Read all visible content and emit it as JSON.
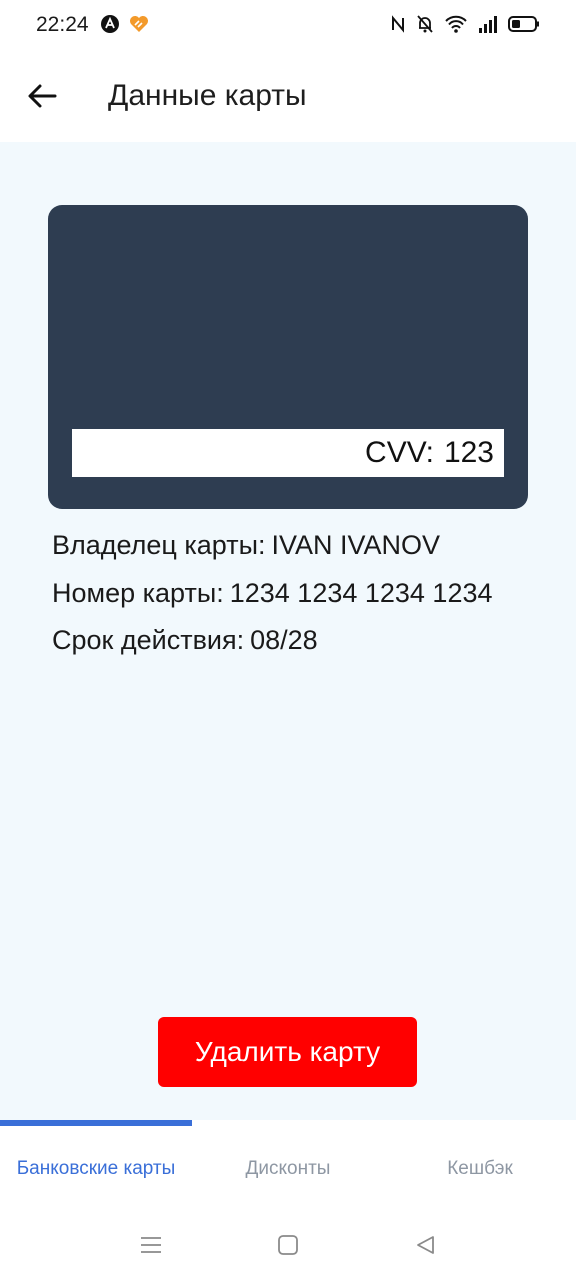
{
  "status_bar": {
    "time": "22:24",
    "left_icons": [
      "app-a-icon",
      "heart-app-icon"
    ],
    "right_icons": [
      "nfc-icon",
      "bell-off-icon",
      "wifi-icon",
      "signal-icon",
      "battery-icon"
    ]
  },
  "header": {
    "back_icon": "arrow-left-icon",
    "title": "Данные карты"
  },
  "card": {
    "cvv_label": "CVV:",
    "cvv_value": "123"
  },
  "details": {
    "owner_label": "Владелец карты:",
    "owner_value": "IVAN IVANOV",
    "number_label": "Номер карты:",
    "number_value": "1234 1234 1234 1234",
    "expiry_label": "Срок действия:",
    "expiry_value": "08/28"
  },
  "actions": {
    "delete_label": "Удалить карту"
  },
  "tabs": [
    {
      "label": "Банковские карты",
      "active": true
    },
    {
      "label": "Дисконты",
      "active": false
    },
    {
      "label": "Кешбэк",
      "active": false
    }
  ],
  "nav": [
    "menu-icon",
    "home-square-icon",
    "back-triangle-icon"
  ],
  "colors": {
    "accent": "#3a6fd8",
    "card": "#2e3d51",
    "danger": "#ff0000",
    "background": "#f2f9fd"
  }
}
